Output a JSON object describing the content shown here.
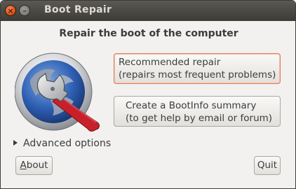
{
  "window": {
    "title": "Boot Repair",
    "close_glyph": "×",
    "minimize_glyph": "–"
  },
  "heading": "Repair the boot of the computer",
  "logo_icon": "boot-repair-wrench-logo-icon",
  "recommended": {
    "line1": "Recommended repair",
    "line2": "(repairs most frequent problems)"
  },
  "bootinfo": {
    "line1": "Create a BootInfo summary",
    "line2": "(to get help by email or forum)"
  },
  "advanced_label": "Advanced options",
  "about": {
    "mnemonic": "A",
    "rest": "bout"
  },
  "quit_label": "Quit",
  "colors": {
    "titlebar": "#3c3b37",
    "window_bg": "#f2f1f0",
    "focus_border": "#e07a52",
    "close_button": "#e0531a"
  }
}
